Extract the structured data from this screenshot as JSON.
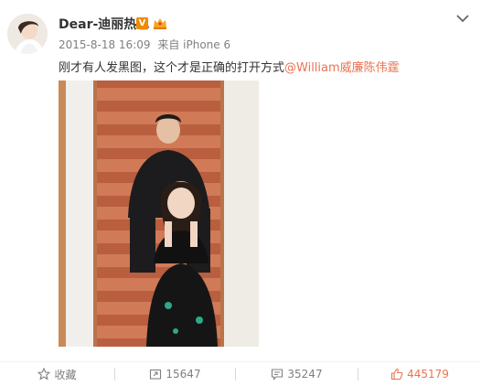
{
  "post": {
    "username": "Dear-迪丽热巴",
    "verified_badge": "V",
    "timestamp": "2015-8-18 16:09",
    "source": "来自 iPhone 6",
    "text": "刚才有人发黑图，这个才是正确的打开方式",
    "mention": "@William威廉陈伟霆",
    "photo_icon": "photo-two-people-sitting-on-stairs"
  },
  "actions": {
    "favorite_label": "收藏",
    "repost_count": "15647",
    "comment_count": "35247",
    "like_count": "445179"
  },
  "colors": {
    "accent": "#eb7350",
    "badge": "#f08a00",
    "meta": "#808080"
  }
}
